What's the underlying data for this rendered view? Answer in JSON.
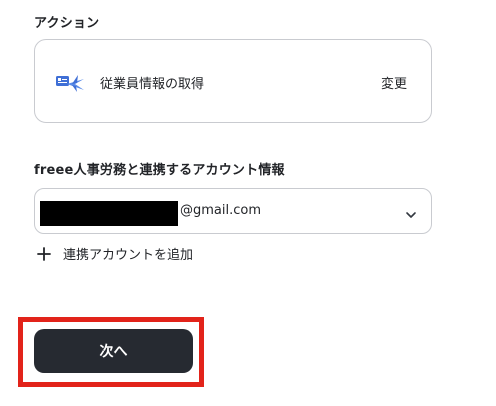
{
  "action_section": {
    "title": "アクション",
    "action_name": "従業員情報の取得",
    "change_label": "変更",
    "app_icon": "freee-hr-icon"
  },
  "account_section": {
    "title": "freee人事労務と連携するアカウント情報",
    "selected_account": "@gmail.com",
    "add_account_label": "連携アカウントを追加"
  },
  "footer": {
    "next_label": "次へ"
  },
  "colors": {
    "primary_button": "#262a31",
    "highlight": "#e2231a",
    "border": "#c9cbd0",
    "icon_blue": "#3f6fd6"
  }
}
